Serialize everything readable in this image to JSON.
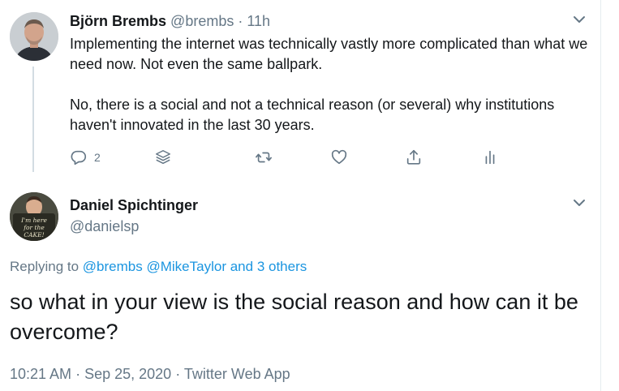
{
  "parent_tweet": {
    "author_name": "Björn Brembs",
    "handle": "@brembs",
    "separator": "·",
    "time": "11h",
    "text_paragraphs": [
      "Implementing the internet was technically vastly more complicated than what we need now. Not even the same ballpark.",
      "No, there is a social and not a technical reason (or several) why institutions haven't innovated in the last 30 years."
    ],
    "actions": {
      "reply_count": "2"
    }
  },
  "main_tweet": {
    "author_name": "Daniel Spichtinger",
    "handle": "@danielsp",
    "avatar_sign": [
      "I'm here",
      "for the",
      "CAKE!"
    ],
    "replying": {
      "prefix": "Replying to",
      "user1": "@brembs",
      "user2": "@MikeTaylor",
      "conjunction": "and",
      "others": "3 others"
    },
    "text": "so what in your view is the social reason and how can it be overcome?",
    "time": "10:21 AM",
    "sep1": "·",
    "date": "Sep 25, 2020",
    "sep2": "·",
    "source": "Twitter Web App"
  },
  "colors": {
    "link": "#1b95e0",
    "muted": "#657786",
    "text": "#14171a",
    "thread_line": "#d3dce3"
  }
}
